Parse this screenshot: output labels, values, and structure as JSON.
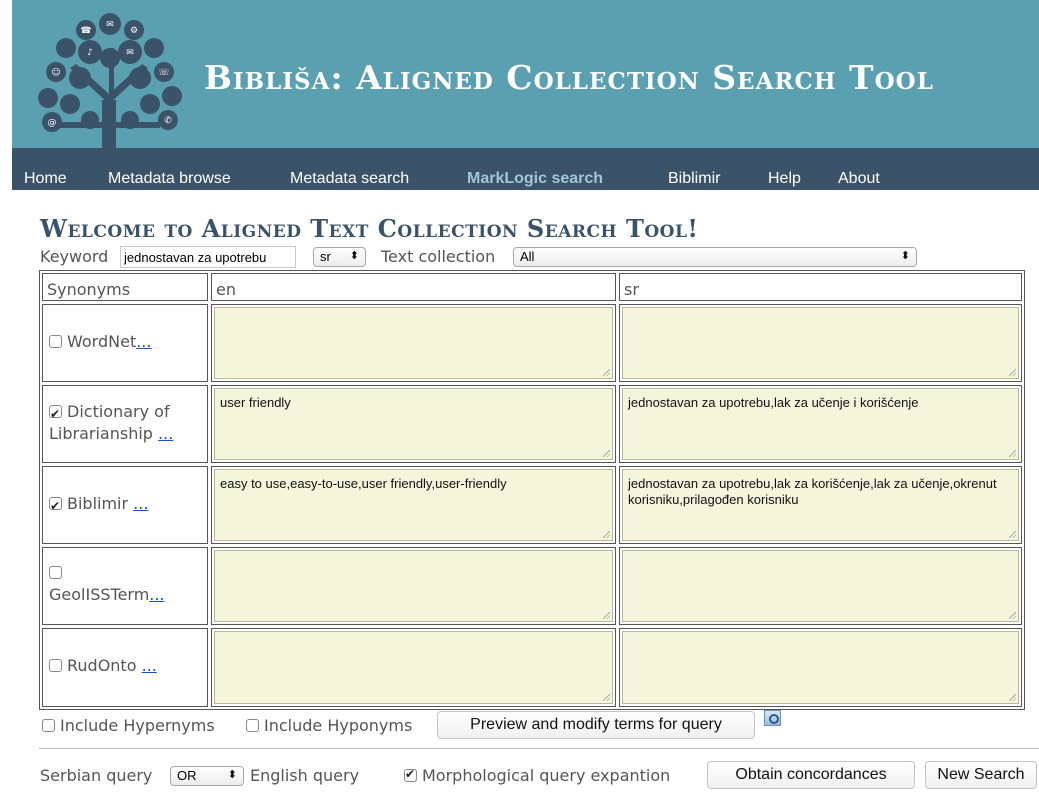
{
  "site_title": "Bibliša: Aligned Collection Search Tool",
  "nav": [
    "Home",
    "Metadata browse",
    "Metadata search",
    "MarkLogic search",
    "Biblimir",
    "Help",
    "About"
  ],
  "nav_active": "MarkLogic search",
  "welcome": "Welcome to Aligned Text Collection Search Tool!",
  "search": {
    "keyword_label": "Keyword",
    "keyword_value": "jednostavan za upotrebu",
    "lang_value": "sr",
    "collection_label": "Text collection",
    "collection_value": "All"
  },
  "table": {
    "headers": [
      "Synonyms",
      "en",
      "sr"
    ],
    "rows": [
      {
        "name": "WordNet",
        "more": "...",
        "checked": false,
        "en": "",
        "sr": ""
      },
      {
        "name": "Dictionary of Librarianship",
        "more": "...",
        "checked": true,
        "en": "user friendly",
        "sr": "jednostavan za upotrebu,lak za učenje i korišćenje"
      },
      {
        "name": "Biblimir",
        "more": "...",
        "checked": true,
        "en": "easy to use,easy-to-use,user friendly,user-friendly",
        "sr": "jednostavan za upotrebu,lak za korišćenje,lak za učenje,okrenut korisniku,prilagođen korisniku"
      },
      {
        "name": "GeolISSTerm",
        "more": "...",
        "checked": false,
        "en": "",
        "sr": ""
      },
      {
        "name": "RudOnto",
        "more": "...",
        "checked": false,
        "en": "",
        "sr": ""
      }
    ]
  },
  "options": {
    "include_hypernyms": "Include Hypernyms",
    "include_hyponyms": "Include Hyponyms",
    "preview_button": "Preview and modify terms for query"
  },
  "bottom": {
    "serbian_query_label": "Serbian query",
    "operator_value": "OR",
    "english_query_label": "English query",
    "morph_label": "Morphological query expantion",
    "obtain_button": "Obtain concordances",
    "new_search_button": "New Search"
  },
  "colors": {
    "header_bg": "#5aa0b0",
    "nav_bg": "#3b5368",
    "nav_active": "#9ec6d6",
    "textarea_bg": "#f5f5dc",
    "welcome_text": "#3b5368"
  }
}
